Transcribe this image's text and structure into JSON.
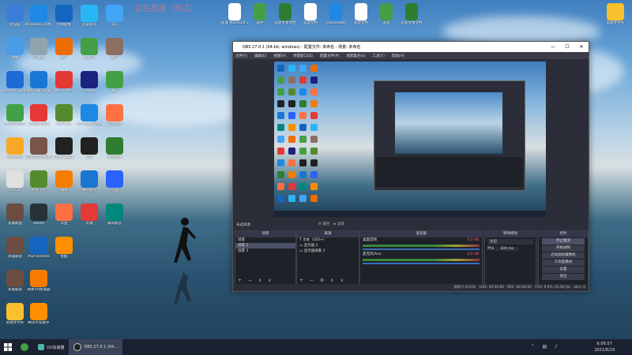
{
  "watermark": "正在直播（测试）",
  "desktop_icons_left": [
    {
      "label": "此电脑",
      "color": "#3b7dd8"
    },
    {
      "label": "Windows 10激活",
      "color": "#1e88e5"
    },
    {
      "label": "网络",
      "color": "#4a9be8"
    },
    {
      "label": "回收站",
      "color": "#90a4ae"
    },
    {
      "label": "Internet Explorer",
      "color": "#1e6bd6"
    },
    {
      "label": "搜狗高速浏览器",
      "color": "#1976d2"
    },
    {
      "label": "360安全卫士",
      "color": "#43a047"
    },
    {
      "label": "360软件管家",
      "color": "#e53935"
    },
    {
      "label": "WeGame",
      "color": "#f9a825"
    },
    {
      "label": "英雄联盟WeGame版",
      "color": "#795548"
    },
    {
      "label": "CS:GO",
      "color": "#e0e0e0"
    },
    {
      "label": "绝地求生",
      "color": "#558b2f"
    },
    {
      "label": "英雄联盟",
      "color": "#6d4c41"
    },
    {
      "label": "Steam",
      "color": "#263238"
    },
    {
      "label": "英雄联盟",
      "color": "#6d4c41"
    },
    {
      "label": "PS4 Remote",
      "color": "#1565c0"
    },
    {
      "label": "英雄联盟",
      "color": "#6d4c41"
    },
    {
      "label": "网易UU加速器",
      "color": "#f57c00"
    },
    {
      "label": "新建文件夹",
      "color": "#fbc02d"
    },
    {
      "label": "腾讯手游助手",
      "color": "#ff8f00"
    }
  ],
  "desktop_icons_top": [
    {
      "label": "控制面板",
      "color": "#1565c0"
    },
    {
      "label": "迅雷影音",
      "color": "#29b6f6"
    },
    {
      "label": "QQ",
      "color": "#42a5f5"
    },
    {
      "label": "用户",
      "color": "#ef6c00"
    },
    {
      "label": "爱奇艺",
      "color": "#43a047"
    },
    {
      "label": "账户",
      "color": "#8d6e63"
    },
    {
      "label": "WPS Office",
      "color": "#e53935"
    },
    {
      "label": "Steam",
      "color": "#1a237e"
    },
    {
      "label": "微信",
      "color": "#43a047"
    },
    {
      "label": "GeForce",
      "color": "#558b2f"
    },
    {
      "label": "Microsoft Edge",
      "color": "#1e88e5"
    },
    {
      "label": "斗鱼直播",
      "color": "#ff7043"
    },
    {
      "label": "OBS Studio",
      "color": "#212121"
    },
    {
      "label": "QQ",
      "color": "#212121"
    },
    {
      "label": "360软件",
      "color": "#2e7d32"
    },
    {
      "label": "微博",
      "color": "#f57c00"
    },
    {
      "label": "腾讯会议",
      "color": "#1976d2"
    },
    {
      "label": "迅雷",
      "color": "#2962ff"
    },
    {
      "label": "斗鱼",
      "color": "#ff7043"
    },
    {
      "label": "火绒",
      "color": "#e53935"
    },
    {
      "label": "暴风影音",
      "color": "#00897b"
    },
    {
      "label": "优酷",
      "color": "#ff8f00"
    }
  ],
  "desktop_files_top": [
    {
      "label": "新建 Microsoft Excel 工作表",
      "color": "#ffffff"
    },
    {
      "label": "软件",
      "color": "#43a047"
    },
    {
      "label": "新建文本文档",
      "color": "#2e7d32"
    },
    {
      "label": "新建文档",
      "color": "#ffffff"
    },
    {
      "label": "TeamViewer",
      "color": "#1e88e5"
    },
    {
      "label": "新建文档",
      "color": "#ffffff"
    },
    {
      "label": "游戏",
      "color": "#43a047"
    },
    {
      "label": "新建文本文档",
      "color": "#2e7d32"
    },
    {
      "label": "新建文件夹",
      "color": "#fbc02d"
    }
  ],
  "obs": {
    "title": "OBS 27.0.1 (64-bit, windows) - 配置文件: 未命名 - 场景: 未命名",
    "menus": [
      "文件(F)",
      "编辑(E)",
      "视图(V)",
      "停靠窗口(D)",
      "配置文件(P)",
      "场景集合(S)",
      "工具(T)",
      "帮助(H)"
    ],
    "no_source_selected": "未选择源",
    "properties_label": "属性",
    "filters_label": "滤镜",
    "scenes_header": "场景",
    "scenes": [
      "场景",
      "场景 2",
      "场景 3"
    ],
    "sources_header": "来源",
    "sources": [
      "文本（GDI+）",
      "显示器 2",
      "显示器采集 3"
    ],
    "mixer_header": "混音器",
    "mixer": [
      {
        "name": "桌面音频",
        "db": "0.0 dB"
      },
      {
        "name": "麦克风/Aux",
        "db": "0.0 dB"
      }
    ],
    "transitions_header": "转场特效",
    "transition_type": "淡出",
    "duration_label": "时长",
    "duration_value": "300 ms",
    "controls_header": "控件",
    "controls": [
      "停止推流",
      "开始录制",
      "启动虚拟摄像机",
      "工作室模式",
      "设置",
      "退出"
    ],
    "status": {
      "dropped": "丢帧 0 (0.0%)",
      "live": "LIVE: 00:00:00",
      "rec": "REC: 00:00:00",
      "cpu": "CPU: 0.9%, 60.00 fps",
      "kbps": "kb/s: 0"
    }
  },
  "taskbar": {
    "items": [
      "UU加速器",
      "OBS 27.0.1 (64..."
    ],
    "time": "6:06:57",
    "date": "2021/8/19"
  }
}
